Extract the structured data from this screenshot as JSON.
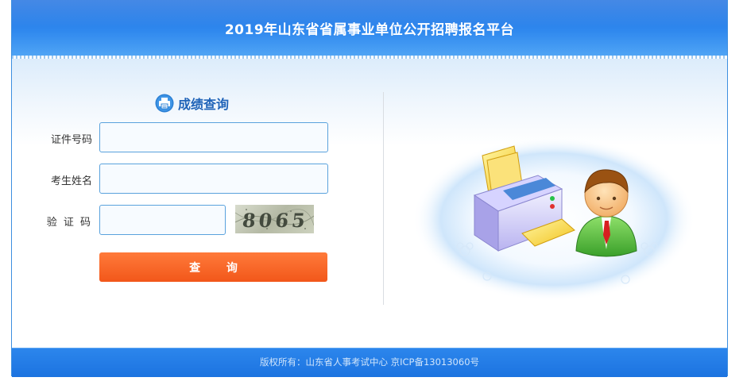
{
  "header": {
    "title": "2019年山东省省属事业单位公开招聘报名平台"
  },
  "form": {
    "title": "成绩查询",
    "fields": [
      {
        "label": "证件号码",
        "value": "",
        "placeholder": ""
      },
      {
        "label": "考生姓名",
        "value": "",
        "placeholder": ""
      },
      {
        "label": "验 证 码",
        "value": "",
        "placeholder": ""
      }
    ],
    "captcha_text": "8065",
    "submit_label": "查 询"
  },
  "footer": {
    "text": "版权所有：山东省人事考试中心  京ICP备13013060号"
  },
  "colors": {
    "header_blue": "#2f88ee",
    "title_blue": "#1f63b8",
    "button_orange": "#f8631f",
    "footer_blue": "#2480e6"
  },
  "icons": [
    "printer-icon",
    "printer-illustration",
    "person-illustration"
  ]
}
